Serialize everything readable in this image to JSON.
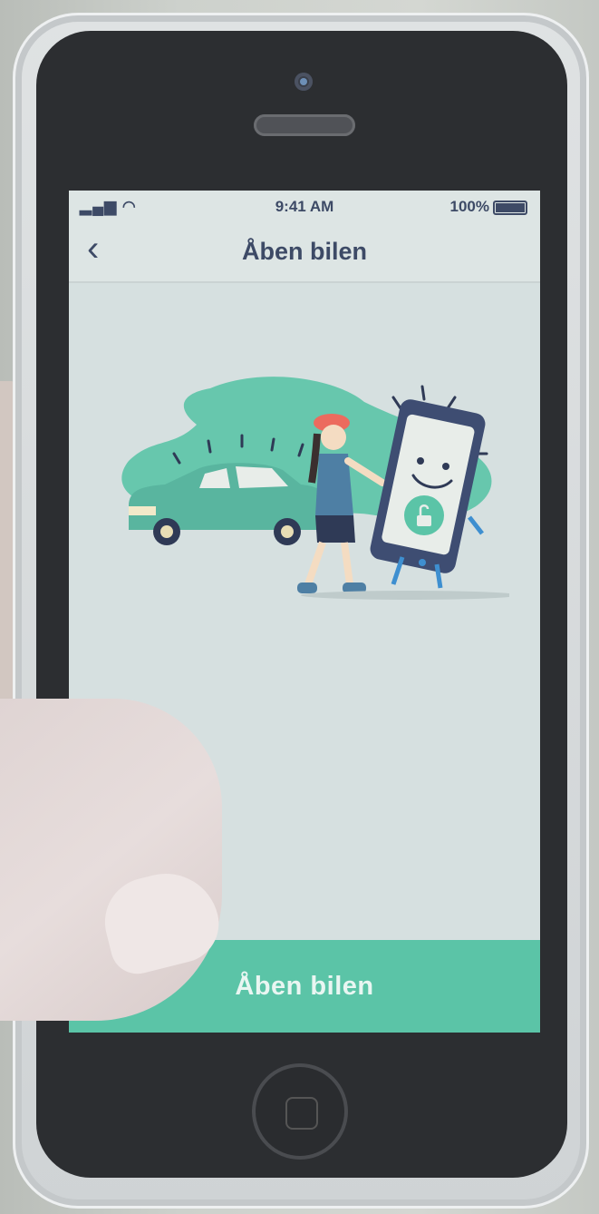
{
  "status_bar": {
    "time": "9:41 AM",
    "battery": "100%"
  },
  "nav": {
    "back_icon": "chevron-left-icon",
    "title": "Åben bilen"
  },
  "illustration": {
    "description_icon": "unlock-car-illustration",
    "colors": {
      "teal": "#5bc4a7",
      "car_body": "#59b59f",
      "phone_frame": "#3e4d72",
      "person_shirt": "#4e7fa4",
      "hat": "#ec6b5e"
    }
  },
  "primary_button": {
    "label": "Åben bilen"
  },
  "colors": {
    "accent": "#5bc4a7",
    "text": "#3d4a66",
    "background": "#d6e0e0"
  }
}
